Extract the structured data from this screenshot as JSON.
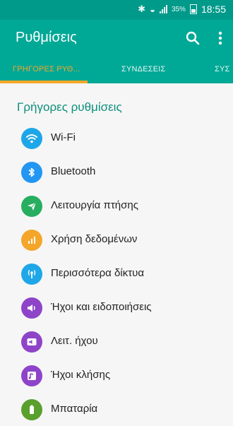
{
  "status": {
    "battery_percent": "35%",
    "time": "18:55"
  },
  "appbar": {
    "title": "Ρυθμίσεις"
  },
  "tabs": [
    {
      "label": "ΓΡΗΓΟΡΕΣ ΡΥΘ..."
    },
    {
      "label": "ΣΥΝΔΕΣΕΙΣ"
    },
    {
      "label": "ΣΥΣ"
    }
  ],
  "section_title": "Γρήγορες ρυθμίσεις",
  "items": [
    {
      "label": "Wi-Fi",
      "icon": "wifi-icon",
      "color": "#1ea7e8"
    },
    {
      "label": "Bluetooth",
      "icon": "bluetooth-icon",
      "color": "#2196f3"
    },
    {
      "label": "Λειτουργία πτήσης",
      "icon": "airplane-icon",
      "color": "#27ae60"
    },
    {
      "label": "Χρήση δεδομένων",
      "icon": "data-usage-icon",
      "color": "#f4a62a"
    },
    {
      "label": "Περισσότερα δίκτυα",
      "icon": "network-icon",
      "color": "#1ea7e8"
    },
    {
      "label": "Ήχοι και ειδοποιήσεις",
      "icon": "speaker-icon",
      "color": "#8e44c8"
    },
    {
      "label": "Λειτ. ήχου",
      "icon": "sound-mode-icon",
      "color": "#8e44c8"
    },
    {
      "label": "Ήχοι κλήσης",
      "icon": "ringtone-icon",
      "color": "#8e44c8"
    },
    {
      "label": "Μπαταρία",
      "icon": "battery-icon",
      "color": "#5aa02c"
    }
  ]
}
